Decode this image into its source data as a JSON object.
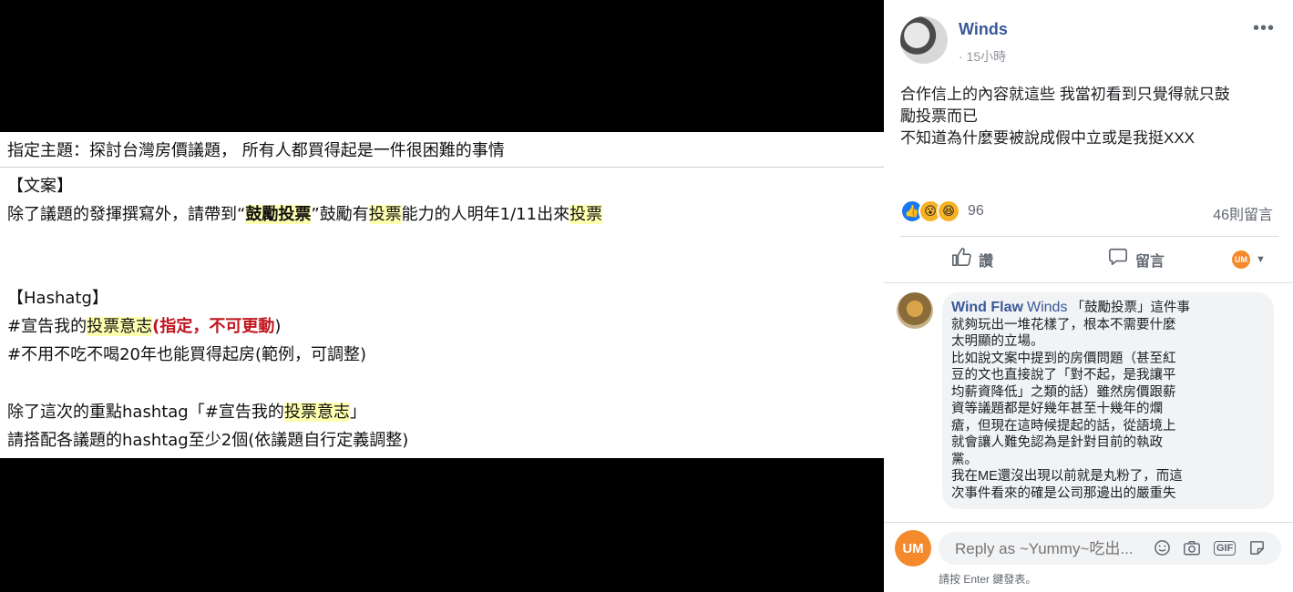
{
  "document": {
    "topic_line": "指定主題：探討台灣房價議題， 所有人都買得起是一件很困難的事情",
    "copy_heading": "【文案】",
    "copy_line": {
      "p1": "除了議題的發揮撰寫外，請帶到",
      "q1": "“",
      "h1": "鼓勵投票",
      "q2": "”",
      "p2": "鼓勵有",
      "h2": "投票",
      "p3": "能力的人明年1/11出來",
      "h3": "投票"
    },
    "hashtag_heading": "【Hashatg】",
    "tag1": {
      "p1": "#宣告我的",
      "h1": "投票意志",
      "r": "(指定，不可更動",
      "p2": ")"
    },
    "tag2": "#不用不吃不喝20年也能買得起房(範例，可調整)",
    "extra1": {
      "p1": "除了這次的重點hashtag「#宣告我的",
      "h1": "投票意志",
      "p2": "」"
    },
    "extra2": "請搭配各議題的hashtag至少2個(依議題自行定義調整)"
  },
  "post": {
    "author": "Winds",
    "time": "· 15小時",
    "body_lines": [
      "合作信上的內容就這些 我當初看到只覺得就只鼓",
      "勵投票而已",
      "不知道為什麼要被說成假中立或是我挺XXX"
    ],
    "reaction_count": "96",
    "comment_count": "46則留言",
    "like_label": "讚",
    "comment_label": "留言",
    "more_icon": "•••"
  },
  "comment": {
    "author": "Wind Flaw",
    "tag": "Winds",
    "lines": [
      " 「鼓勵投票」這件事",
      "就夠玩出一堆花樣了，根本不需要什麼",
      "太明顯的立場。",
      "比如說文案中提到的房價問題（甚至紅",
      "豆的文也直接說了「對不起，是我讓平",
      "均薪資降低」之類的話）雖然房價跟薪",
      "資等議題都是好幾年甚至十幾年的爛",
      "瘡，但現在這時候提起的話，從語境上",
      "就會讓人難免認為是針對目前的執政",
      "黨。",
      "我在ME還沒出現以前就是丸粉了，而這",
      "次事件看來的確是公司那邊出的嚴重失"
    ]
  },
  "reply": {
    "placeholder": "Reply as ~Yummy~吃出...",
    "hint": "請按 Enter 鍵發表。",
    "avatar_text": "UM",
    "gif_label": "GIF"
  },
  "icons": {
    "like": "thumbs-up-icon",
    "comment": "speech-bubble-icon",
    "emoji": "smiley-icon",
    "camera": "camera-icon",
    "gif": "gif-icon",
    "sticker": "sticker-icon"
  },
  "colors": {
    "link_blue": "#385898",
    "highlight_yellow": "#ffffb0",
    "mandatory_red": "#c0161f",
    "like_blue": "#1877f2"
  }
}
